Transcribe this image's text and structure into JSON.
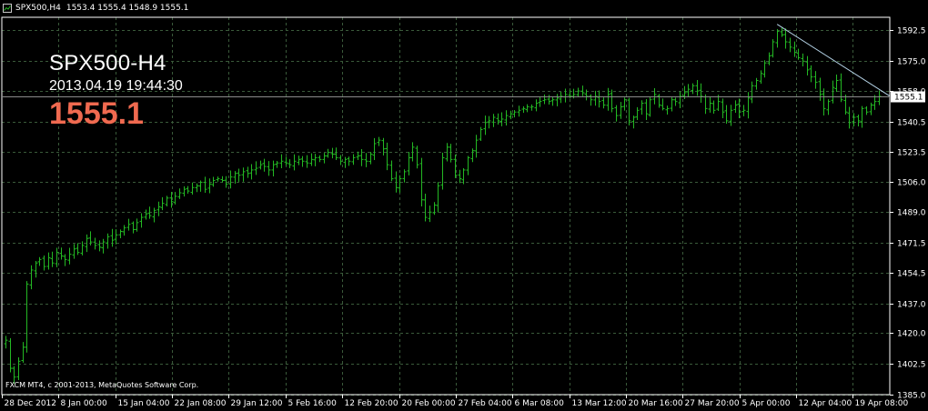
{
  "header": {
    "title": "SPX500,H4",
    "ohlc": "1553.4 1555.4 1548.9 1555.1"
  },
  "overlay": {
    "symbol": "SPX500-H4",
    "datetime": "2013.04.19 19:44:30",
    "price": "1555.1"
  },
  "footer": {
    "copyright": "FXCM MT4, c 2001-2013, MetaQuotes Software Corp."
  },
  "colors": {
    "background": "#000000",
    "candle": "#23b823",
    "grid": "#3a5a3a",
    "axis": "#ffffff",
    "trendline": "#b4d2e6",
    "price_text": "#f06a50",
    "current_price_box": "#ffffff"
  },
  "icons": {
    "header": "chart-window-icon"
  },
  "chart_data": {
    "type": "candlestick",
    "title": "",
    "xlabel": "",
    "ylabel": "",
    "ylim": [
      1385.0,
      1600.0
    ],
    "grid": true,
    "y_ticks": [
      "1592.5",
      "1575.0",
      "1558.0",
      "1540.5",
      "1523.5",
      "1506.0",
      "1489.0",
      "1471.5",
      "1454.5",
      "1437.0",
      "1420.0",
      "1402.5",
      "1385.0"
    ],
    "x_ticks": [
      "28 Dec 2012",
      "8 Jan 00:00",
      "15 Jan 04:00",
      "22 Jan 08:00",
      "29 Jan 12:00",
      "5 Feb 16:00",
      "12 Feb 20:00",
      "20 Feb 00:00",
      "27 Feb 04:00",
      "6 Mar 08:00",
      "13 Mar 12:00",
      "20 Mar 16:00",
      "27 Mar 20:00",
      "5 Apr 00:00",
      "12 Apr 04:00",
      "19 Apr 08:00"
    ],
    "current_price": "1555.1",
    "close_series": [
      1416,
      1400,
      1395,
      1404,
      1412,
      1448,
      1456,
      1460,
      1462,
      1458,
      1463,
      1460,
      1466,
      1464,
      1462,
      1465,
      1468,
      1466,
      1470,
      1474,
      1472,
      1470,
      1469,
      1472,
      1475,
      1473,
      1476,
      1478,
      1480,
      1482,
      1479,
      1483,
      1486,
      1488,
      1487,
      1490,
      1492,
      1494,
      1497,
      1495,
      1498,
      1500,
      1502,
      1501,
      1503,
      1504,
      1506,
      1502,
      1505,
      1507,
      1508,
      1507,
      1505,
      1509,
      1511,
      1510,
      1512,
      1511,
      1513,
      1514,
      1516,
      1515,
      1513,
      1516,
      1517,
      1518,
      1517,
      1516,
      1518,
      1519,
      1518,
      1517,
      1519,
      1520,
      1519,
      1521,
      1523,
      1522,
      1520,
      1518,
      1519,
      1518,
      1520,
      1521,
      1519,
      1518,
      1522,
      1528,
      1530,
      1525,
      1516,
      1508,
      1503,
      1508,
      1512,
      1520,
      1526,
      1516,
      1496,
      1486,
      1489,
      1493,
      1504,
      1520,
      1526,
      1519,
      1510,
      1508,
      1513,
      1520,
      1524,
      1530,
      1536,
      1540,
      1541,
      1543,
      1541,
      1542,
      1544,
      1545,
      1546,
      1547,
      1548,
      1549,
      1549,
      1551,
      1552,
      1553,
      1552,
      1553,
      1554,
      1555,
      1556,
      1555,
      1556,
      1558,
      1557,
      1555,
      1553,
      1555,
      1552,
      1550,
      1556,
      1548,
      1544,
      1549,
      1553,
      1541,
      1543,
      1547,
      1551,
      1545,
      1553,
      1556,
      1550,
      1548,
      1548,
      1553,
      1552,
      1555,
      1557,
      1559,
      1561,
      1558,
      1555,
      1548,
      1551,
      1547,
      1552,
      1546,
      1541,
      1547,
      1550,
      1546,
      1547,
      1554,
      1561,
      1564,
      1568,
      1574,
      1578,
      1586,
      1592,
      1590,
      1586,
      1583,
      1580,
      1577,
      1575,
      1570,
      1566,
      1563,
      1556,
      1548,
      1552,
      1560,
      1564,
      1553,
      1546,
      1540,
      1543,
      1541,
      1548,
      1546,
      1550,
      1552,
      1555
    ]
  }
}
